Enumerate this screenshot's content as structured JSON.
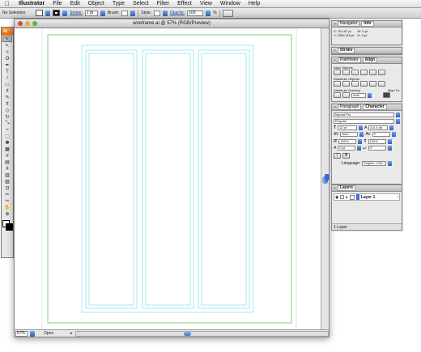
{
  "menubar": {
    "apple": "",
    "app_name": "Illustrator",
    "menus": [
      "File",
      "Edit",
      "Object",
      "Type",
      "Select",
      "Filter",
      "Effect",
      "View",
      "Window",
      "Help"
    ]
  },
  "control_bar": {
    "selection_label": "No Selection",
    "stroke_label": "Stroke:",
    "stroke_value": "1 pt",
    "brush_label": "Brush:",
    "style_label": "Style:",
    "opacity_label": "Opacity:",
    "opacity_value": "100",
    "opacity_unit": "%"
  },
  "toolbox": {
    "header": "Ai",
    "tools": [
      "selection-tool",
      "direct-selection-tool",
      "magic-wand-tool",
      "lasso-tool",
      "pen-tool",
      "type-tool",
      "line-tool",
      "rectangle-tool",
      "paintbrush-tool",
      "pencil-tool",
      "blob-brush-tool",
      "eraser-tool",
      "rotate-tool",
      "scale-tool",
      "warp-tool",
      "free-transform-tool",
      "symbol-sprayer-tool",
      "column-graph-tool",
      "mesh-tool",
      "gradient-tool",
      "eyedropper-tool",
      "live-paint-tool",
      "live-paint-selection-tool",
      "crop-tool",
      "slice-tool",
      "scissors-tool",
      "hand-tool",
      "zoom-tool"
    ],
    "tool_glyphs": [
      "↖",
      "↖",
      "✧",
      "ʘ",
      "✒",
      "T",
      "/",
      "▭",
      "ǂ",
      "✎",
      "ǂ",
      "◇",
      "↻",
      "⤡",
      "≈",
      "⬚",
      "✽",
      "▦",
      "#",
      "▤",
      "ǂ",
      "▥",
      "▨",
      "⊡",
      "✂",
      "✂",
      "✋",
      "⊕"
    ],
    "fill_color": "#ffffff",
    "stroke_color": "#000000"
  },
  "document": {
    "title": "wireframe.ai @ 57% (RGB/Preview)",
    "zoom": "57%",
    "status_text": "Open",
    "artboard_color": "#7ed67e",
    "column_color": "#8fe3ef"
  },
  "navigator_panel": {
    "tabs": [
      "Navigator",
      "Info"
    ],
    "x_label": "X:",
    "x_value": "76.107 pt",
    "y_label": "Y:",
    "y_value": "1505.116 pt",
    "w_label": "W:",
    "w_value": "0 pt",
    "h_label": "H:",
    "h_value": "0 pt"
  },
  "stroke_panel": {
    "tabs": [
      "Stroke"
    ]
  },
  "align_panel": {
    "tabs": [
      "Pathfinder",
      "Align"
    ],
    "align_objects_label": "Align Objects:",
    "distribute_objects_label": "Distribute Objects:",
    "distribute_spacing_label": "Distribute Spacing:",
    "align_to_label": "Align To:",
    "spacing_value": "Auto"
  },
  "character_panel": {
    "tabs": [
      "Paragraph",
      "Character"
    ],
    "font_family": "Myriad Pro",
    "font_style": "Regular",
    "font_size": "12 pt",
    "leading": "(14.4 pt)",
    "kerning": "Auto",
    "tracking": "0",
    "horizontal_scale": "100%",
    "vertical_scale": "100%",
    "baseline_shift": "0 pt",
    "char_rotation": "0°",
    "language_label": "Language:",
    "language_value": "English: USA"
  },
  "layers_panel": {
    "tabs": [
      "Layers"
    ],
    "layer_name": "Layer 1",
    "footer": "1 Layer"
  }
}
